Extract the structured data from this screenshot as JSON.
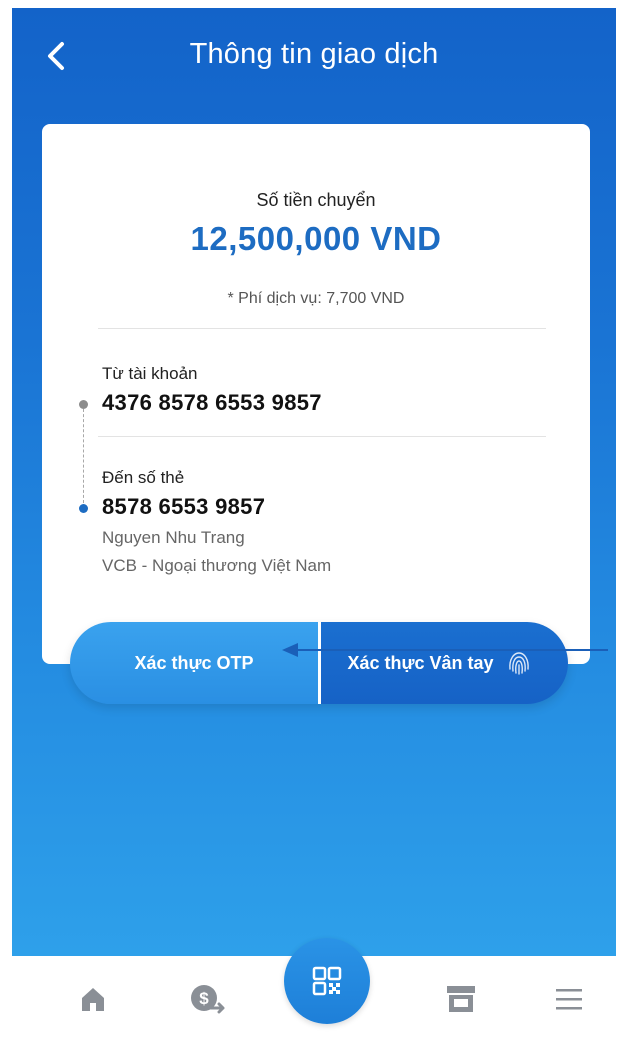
{
  "header": {
    "title": "Thông tin giao dịch",
    "back_icon": "chevron-left-icon"
  },
  "transfer": {
    "amount_label": "Số tiền chuyển",
    "amount_value": "12,500,000 VND",
    "fee_text": "* Phí dịch vụ: 7,700 VND"
  },
  "from": {
    "label": "Từ tài khoản",
    "account": "4376 8578 6553 9857"
  },
  "to": {
    "label": "Đến số thẻ",
    "card": "8578 6553 9857",
    "name": "Nguyen Nhu Trang",
    "bank": "VCB - Ngoại thương Việt Nam"
  },
  "auth": {
    "otp_label": "Xác thực OTP",
    "fingerprint_label": "Xác thực Vân tay",
    "fingerprint_icon": "fingerprint-icon"
  },
  "tabbar": {
    "items": [
      {
        "icon": "home-icon"
      },
      {
        "icon": "money-transfer-icon"
      },
      {
        "icon": "qr-code-icon"
      },
      {
        "icon": "store-icon"
      },
      {
        "icon": "menu-icon"
      }
    ]
  },
  "colors": {
    "primary": "#1d6cc2",
    "gradient_top": "#1363c9",
    "gradient_bottom": "#2ea0ea",
    "otp_button": "#2a8fe3",
    "fingerprint_button": "#1662c6",
    "tab_icon": "#8a8f96"
  }
}
